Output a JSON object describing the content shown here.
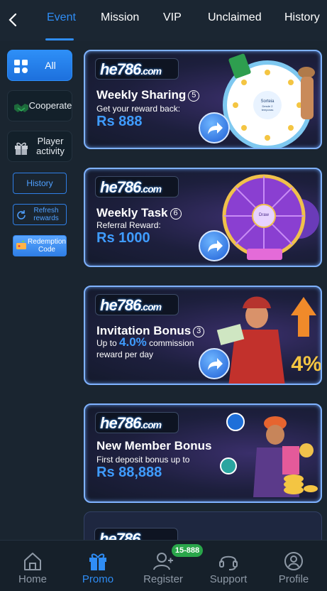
{
  "tabs": [
    {
      "label": "Event",
      "active": true
    },
    {
      "label": "Mission"
    },
    {
      "label": "VIP"
    },
    {
      "label": "Unclaimed"
    },
    {
      "label": "History"
    }
  ],
  "sidebar": {
    "categories": [
      {
        "label": "All",
        "icon": "apps-grid-icon",
        "active": true
      },
      {
        "label": "Cooperate",
        "icon": "handshake-icon"
      },
      {
        "label": "Player activity",
        "icon": "gift-icon"
      }
    ],
    "history_label": "History",
    "refresh_label": "Refresh rewards",
    "redeem_label": "Redemption Code"
  },
  "promos": [
    {
      "brand": "he786",
      "brand_suffix": ".com",
      "title": "Weekly Sharing",
      "num": "5",
      "line1": "Get your reward back:",
      "amount": "Rs 888"
    },
    {
      "brand": "he786",
      "brand_suffix": ".com",
      "title": "Weekly Task",
      "num": "6",
      "line1": "Referral Reward:",
      "amount": "Rs 1000"
    },
    {
      "brand": "he786",
      "brand_suffix": ".com",
      "title": "Invitation Bonus",
      "num": "3",
      "line1_pre": "Up to ",
      "line1_hl": "4.0%",
      "line1_post": " commission",
      "line2": "reward per day",
      "art_text": "4%"
    },
    {
      "brand": "he786",
      "brand_suffix": ".com",
      "title": "New Member Bonus",
      "line1": "First deposit bonus up to",
      "amount": "Rs 88,888"
    }
  ],
  "peek_brand": "he786",
  "wheel_labels": {
    "line1": "Sorteia",
    "line2": "Desde 2",
    "line3": "temporas"
  },
  "draw_label": "Draw",
  "colors": {
    "accent": "#2f8df5",
    "badge": "#2aa64a"
  },
  "nav": [
    {
      "label": "Home",
      "icon": "home-icon"
    },
    {
      "label": "Promo",
      "icon": "gift-icon",
      "active": true
    },
    {
      "label": "Register",
      "icon": "add-user-icon"
    },
    {
      "label": "Support",
      "icon": "headset-icon"
    },
    {
      "label": "Profile",
      "icon": "profile-icon"
    }
  ],
  "register_badge": "15-888"
}
